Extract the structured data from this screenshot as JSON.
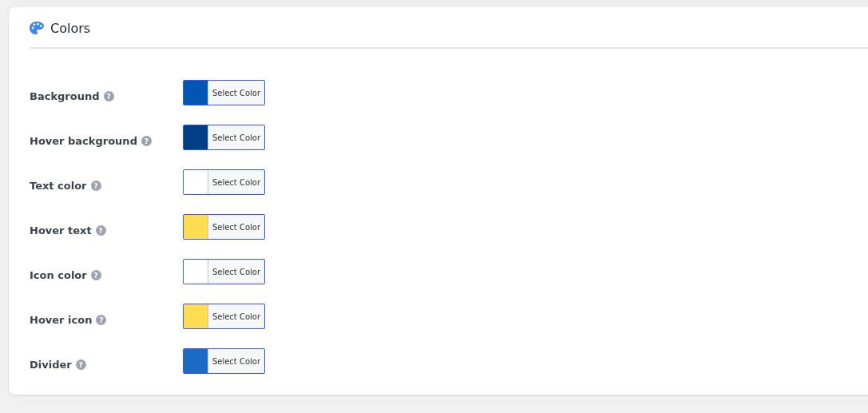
{
  "section": {
    "title": "Colors"
  },
  "fields": [
    {
      "label": "Background",
      "help": "?",
      "color": "#0056b3",
      "button": "Select Color"
    },
    {
      "label": "Hover background",
      "help": "?",
      "color": "#003d86",
      "button": "Select Color"
    },
    {
      "label": "Text color",
      "help": "?",
      "color": "#ffffff",
      "button": "Select Color"
    },
    {
      "label": "Hover text",
      "help": "?",
      "color": "#ffdc52",
      "button": "Select Color"
    },
    {
      "label": "Icon color",
      "help": "?",
      "color": "#ffffff",
      "button": "Select Color"
    },
    {
      "label": "Hover icon",
      "help": "?",
      "color": "#ffdc52",
      "button": "Select Color"
    },
    {
      "label": "Divider",
      "help": "?",
      "color": "#1c6bc2",
      "button": "Select Color"
    }
  ]
}
